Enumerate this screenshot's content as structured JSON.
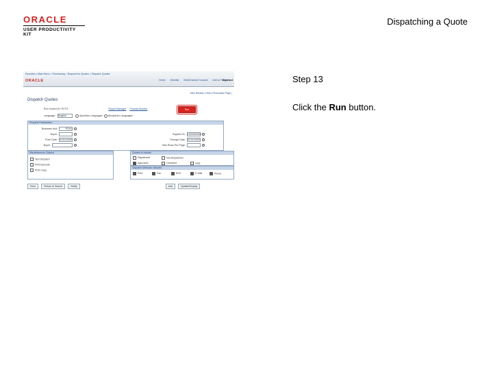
{
  "header": {
    "logo_main": "ORACLE",
    "logo_sub": "USER PRODUCTIVITY KIT",
    "doc_title": "Dispatching a Quote"
  },
  "instructions": {
    "step": "Step 13",
    "prefix": "Click the ",
    "target": "Run",
    "suffix": " button."
  },
  "screenshot": {
    "breadcrumb": "Favorites  |  Main Menu  >  Purchasing  >  Request for Quotes  >  Dispatch Quotes",
    "brand": "ORACLE",
    "top_links": [
      "Home",
      "Worklist",
      "MultiChannel Console",
      "Add to Favorites",
      "Sign out"
    ],
    "toolbar": "New Window  |  Help  |  Personalize Page  |",
    "page_title": "Dispatch Quotes",
    "run_control_label": "Run Control ID:",
    "run_control_value": "PCTS",
    "report_manager": "Report Manager",
    "process_monitor": "Process Monitor",
    "run_button": "Run",
    "language_label": "Language:",
    "language_value": "English",
    "specified_languages": "Specified Languages",
    "recipients_languages": "Recipient's Languages",
    "request_section": "Request Parameters",
    "left_fields": [
      {
        "label": "Business Unit:",
        "value": "PO01"
      },
      {
        "label": "Buyer:",
        "value": ""
      },
      {
        "label": "From Date:",
        "value": "01/01/2000"
      },
      {
        "label": "Buyer:",
        "value": ""
      }
    ],
    "right_fields": [
      {
        "label": "Supplier ID:",
        "value": "1000000000"
      },
      {
        "label": "Through Date:",
        "value": "01/01/2000"
      },
      {
        "label": "Max Rows Per Page:",
        "value": ""
      }
    ],
    "misc_section": "Miscellaneous Options",
    "misc_options": [
      "Test Dispatch",
      "Print Barcode",
      "Print Copy"
    ],
    "quote_section": "Quotes to Include",
    "quote_options": [
      {
        "label": "Dispatched",
        "checked": false
      },
      {
        "label": "Not Dispatched",
        "checked": false
      },
      {
        "label": "Approved",
        "checked": true
      },
      {
        "label": "Canceled",
        "checked": false
      },
      {
        "label": "Hold",
        "checked": false
      }
    ],
    "dispatch_section": "Dispatch Methods Included",
    "dispatch_methods": [
      {
        "label": "Print",
        "checked": true
      },
      {
        "label": "Fax",
        "checked": true
      },
      {
        "label": "EDX",
        "checked": true
      },
      {
        "label": "E-Mail",
        "checked": true
      },
      {
        "label": "Phone",
        "checked": true
      }
    ],
    "bottom_buttons": [
      "Save",
      "Return to Search",
      "Notify"
    ],
    "bottom_right": [
      "Add",
      "Update/Display"
    ]
  }
}
